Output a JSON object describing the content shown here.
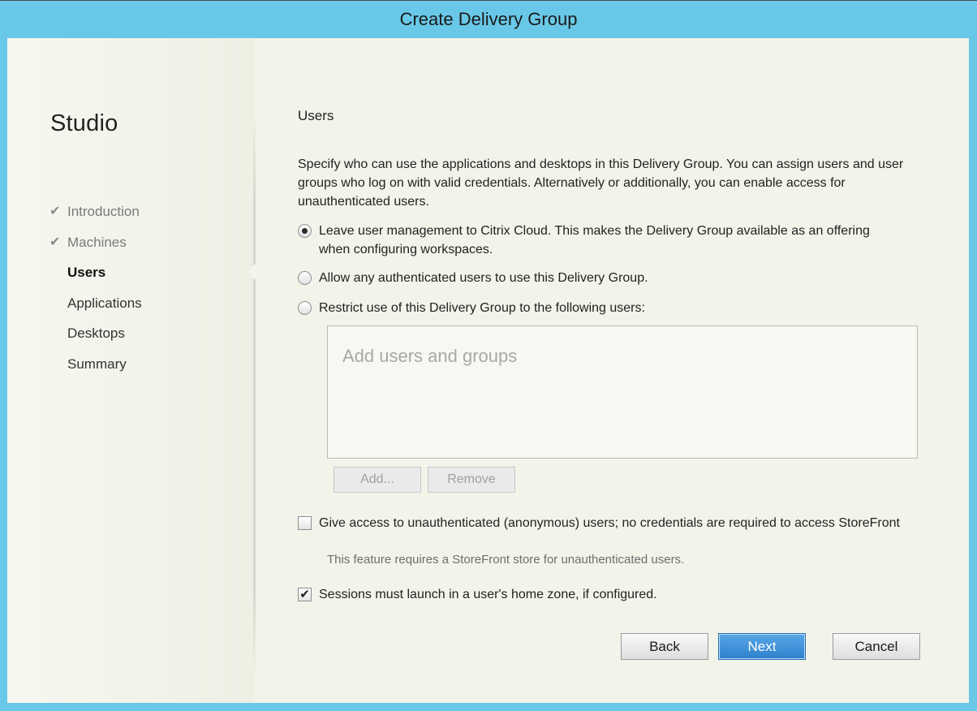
{
  "window": {
    "title": "Create Delivery Group"
  },
  "sidebar": {
    "title": "Studio",
    "steps": [
      {
        "label": "Introduction",
        "state": "done"
      },
      {
        "label": "Machines",
        "state": "done"
      },
      {
        "label": "Users",
        "state": "active"
      },
      {
        "label": "Applications",
        "state": "pending"
      },
      {
        "label": "Desktops",
        "state": "pending"
      },
      {
        "label": "Summary",
        "state": "pending"
      }
    ],
    "check_glyph": "✔"
  },
  "main": {
    "section_title": "Users",
    "description": "Specify who can use the applications and desktops in this Delivery Group. You can assign users and user groups who log on with valid credentials. Alternatively or additionally, you can enable access for unauthenticated users.",
    "options": [
      {
        "label": "Leave user management to Citrix Cloud. This makes the Delivery Group available as an offering when configuring workspaces.",
        "selected": true
      },
      {
        "label": "Allow any authenticated users to use this Delivery Group.",
        "selected": false
      },
      {
        "label": "Restrict use of this Delivery Group to the following users:",
        "selected": false
      }
    ],
    "users_placeholder": "Add users and groups",
    "add_button": "Add...",
    "remove_button": "Remove",
    "anonymous_checkbox": {
      "label": "Give access to unauthenticated (anonymous) users; no credentials are required to access StoreFront",
      "checked": false
    },
    "anonymous_note": "This feature requires a StoreFront store for unauthenticated users.",
    "home_zone_checkbox": {
      "label": "Sessions must launch in a user's home zone, if configured.",
      "checked": true,
      "glyph": "✔"
    }
  },
  "footer": {
    "back_label": "Back",
    "next_label": "Next",
    "cancel_label": "Cancel"
  },
  "colors": {
    "title_bar": "#69c8e8",
    "primary_button": "#2e80cc"
  }
}
